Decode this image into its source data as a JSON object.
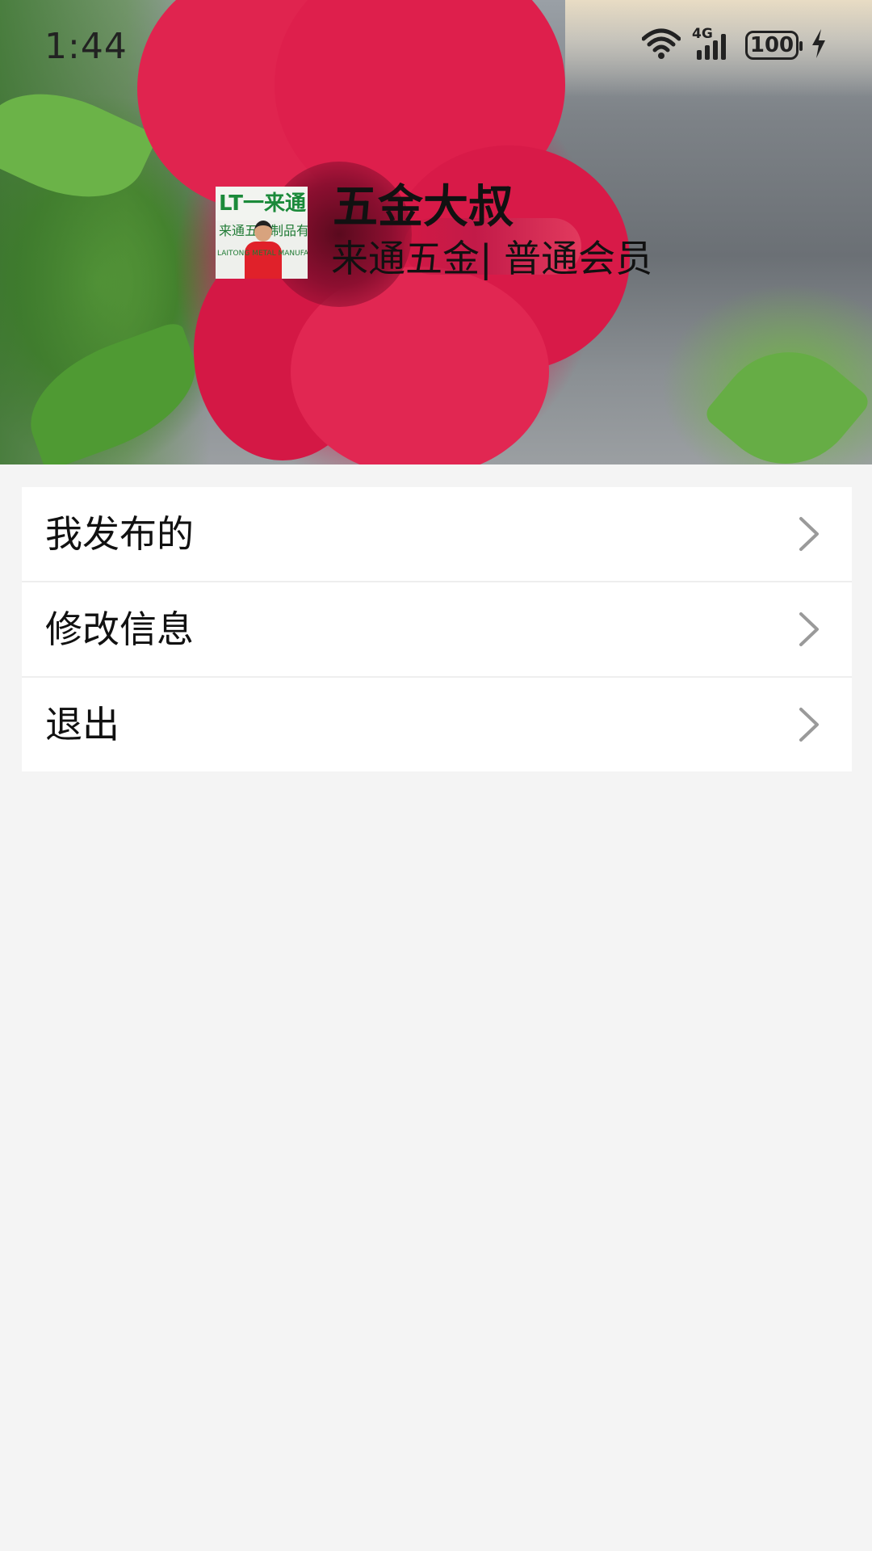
{
  "status_bar": {
    "time": "1:44",
    "network": "4G",
    "battery": "100",
    "icons": [
      "wifi-icon",
      "signal-icon",
      "battery-icon",
      "charging-icon"
    ]
  },
  "profile": {
    "name": "五金大叔",
    "subtitle": "来通五金| 普通会员",
    "avatar": {
      "banner_text": "LT一来通",
      "line2_text": "来通五金制品有",
      "line3_text": "LAITONG METAL MANUFACTUR"
    }
  },
  "menu": {
    "items": [
      {
        "label": "我发布的",
        "icon": "chevron-right-icon"
      },
      {
        "label": "修改信息",
        "icon": "chevron-right-icon"
      },
      {
        "label": "退出",
        "icon": "chevron-right-icon"
      }
    ]
  },
  "colors": {
    "page_background": "#f4f4f4",
    "card_background": "#ffffff",
    "divider": "#eeeeee",
    "chevron": "#9a9a9a",
    "text": "#111111"
  }
}
